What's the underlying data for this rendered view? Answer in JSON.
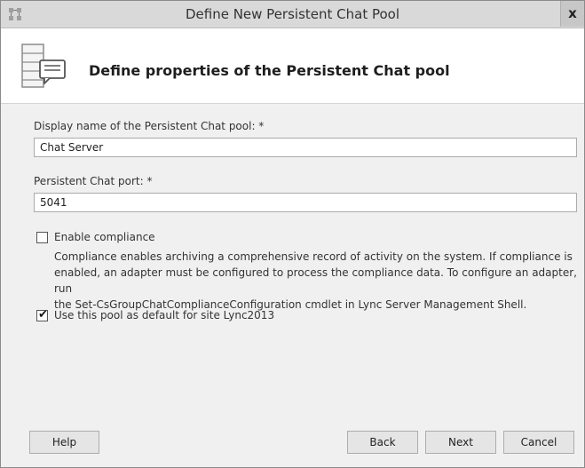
{
  "window": {
    "title": "Define New Persistent Chat Pool",
    "close_label": "x"
  },
  "header": {
    "heading": "Define properties of the Persistent Chat pool"
  },
  "form": {
    "display_name_label": "Display name of the Persistent Chat pool: *",
    "display_name_value": "Chat Server",
    "port_label": "Persistent Chat port: *",
    "port_value": "5041",
    "compliance_label": "Enable compliance",
    "compliance_checked": false,
    "compliance_description_1": "Compliance enables archiving a comprehensive record of activity on the system. If compliance is",
    "compliance_description_2": "enabled, an adapter must be configured to process the compliance data. To configure an adapter, run",
    "compliance_description_3": "the Set-CsGroupChatComplianceConfiguration cmdlet in Lync Server Management Shell.",
    "default_pool_label": "Use this pool as default for site Lync2013",
    "default_pool_checked": true
  },
  "footer": {
    "help_label": "Help",
    "back_label": "Back",
    "next_label": "Next",
    "cancel_label": "Cancel"
  },
  "icons": {
    "app": "app-topology-icon",
    "header": "chat-pool-icon",
    "check": "checkmark-icon"
  }
}
